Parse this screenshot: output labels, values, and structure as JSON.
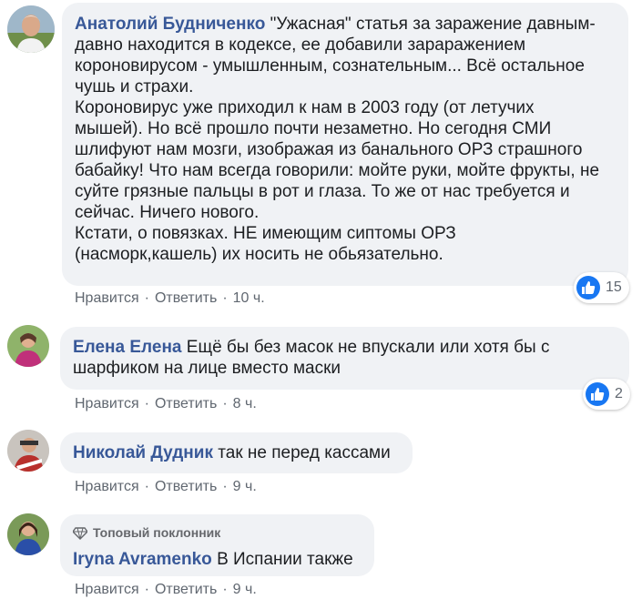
{
  "actions": {
    "like": "Нравится",
    "reply": "Ответить",
    "sep": "·"
  },
  "comments": [
    {
      "author": "Анатолий Будниченко",
      "lines": [
        "\"Ужасная\" статья за заражение давным-",
        "давно находится в кодексе, ее добавили зараражением",
        "короновирусом - умышленным, сознательным... Всё остальное",
        "чушь и страхи.",
        "Короновирус уже приходил к нам в 2003 году (от летучих",
        "мышей). Но всё прошло почти незаметно. Но сегодня СМИ",
        "шлифуют нам мозги, изображая из банального ОРЗ страшного",
        "бабайку! Что нам всегда говорили: мойте руки, мойте фрукты, не",
        "суйте грязные пальцы в рот и глаза. То же от нас требуется и",
        "сейчас. Ничего нового.",
        "Кстати, о повязках. НЕ имеющим сиптомы ОРЗ",
        "(насморк,кашель) их носить не обьязательно."
      ],
      "time": "10 ч.",
      "reactions": "15"
    },
    {
      "author": "Елена Елена",
      "lines": [
        "Ещё бы без масок не впускали или хотя бы с",
        "шарфиком на лице вместо маски"
      ],
      "time": "8 ч.",
      "reactions": "2"
    },
    {
      "author": "Николай Дудник",
      "text": "так не перед кассами",
      "time": "9 ч."
    },
    {
      "author": "Iryna Avramenko",
      "badge": "Топовый поклонник",
      "text": "В Испании также",
      "time": "9 ч."
    }
  ],
  "colors": {
    "author": "#385898",
    "bubble": "#f0f2f5",
    "meta": "#606770",
    "like": "#1877f2"
  }
}
